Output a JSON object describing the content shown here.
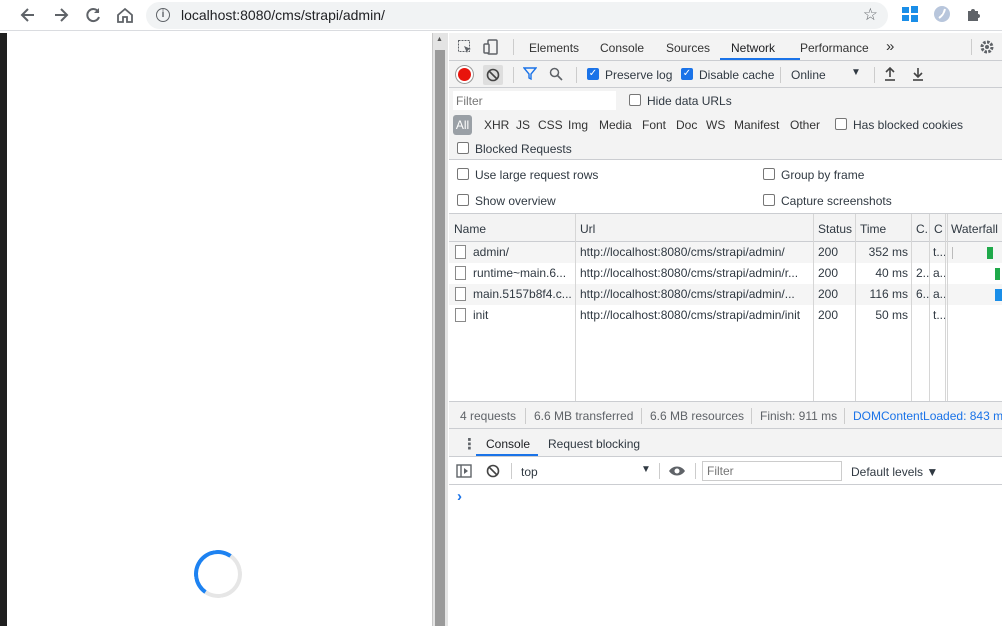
{
  "browser": {
    "url": "localhost:8080/cms/strapi/admin/"
  },
  "devtools": {
    "tabs": [
      "Elements",
      "Console",
      "Sources",
      "Network",
      "Performance"
    ],
    "active_tab": "Network",
    "more_tabs_label": "»",
    "network_toolbar": {
      "preserve_log_label": "Preserve log",
      "preserve_log_checked": true,
      "disable_cache_label": "Disable cache",
      "disable_cache_checked": true,
      "throttling_value": "Online"
    },
    "filter": {
      "placeholder": "Filter",
      "hide_data_urls_label": "Hide data URLs",
      "types": [
        "All",
        "XHR",
        "JS",
        "CSS",
        "Img",
        "Media",
        "Font",
        "Doc",
        "WS",
        "Manifest",
        "Other"
      ],
      "has_blocked_cookies_label": "Has blocked cookies",
      "blocked_requests_label": "Blocked Requests"
    },
    "settings": {
      "large_rows_label": "Use large request rows",
      "group_by_frame_label": "Group by frame",
      "show_overview_label": "Show overview",
      "capture_screenshots_label": "Capture screenshots"
    },
    "table": {
      "columns": [
        "Name",
        "Url",
        "Status",
        "Time",
        "C.",
        "C",
        "Waterfall"
      ],
      "rows": [
        {
          "name": "admin/",
          "url": "http://localhost:8080/cms/strapi/admin/",
          "status": "200",
          "time": "352 ms",
          "c1": "",
          "c2": "t...",
          "wf_color": "#1fa94a"
        },
        {
          "name": "runtime~main.6...",
          "url": "http://localhost:8080/cms/strapi/admin/r...",
          "status": "200",
          "time": "40 ms",
          "c1": "2...",
          "c2": "a...",
          "wf_color": "#1fa94a"
        },
        {
          "name": "main.5157b8f4.c...",
          "url": "http://localhost:8080/cms/strapi/admin/...",
          "status": "200",
          "time": "116 ms",
          "c1": "6...",
          "c2": "a...",
          "wf_color": "#1a8ee8"
        },
        {
          "name": "init",
          "url": "http://localhost:8080/cms/strapi/admin/init",
          "status": "200",
          "time": "50 ms",
          "c1": "",
          "c2": "t...",
          "wf_color": ""
        }
      ]
    },
    "status": {
      "requests": "4 requests",
      "transferred": "6.6 MB transferred",
      "resources": "6.6 MB resources",
      "finish": "Finish: 911 ms",
      "dom_loaded": "DOMContentLoaded: 843 m"
    },
    "drawer": {
      "tabs": [
        "Console",
        "Request blocking"
      ],
      "context": "top",
      "filter_placeholder": "Filter",
      "levels": "Default levels ▼",
      "prompt": "›"
    }
  }
}
